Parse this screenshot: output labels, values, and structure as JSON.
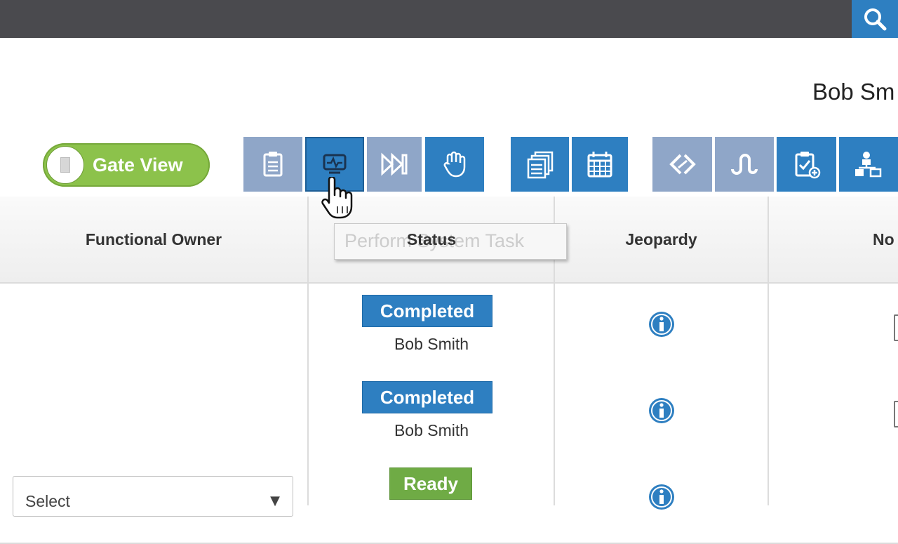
{
  "header": {
    "user_name": "Bob Sm",
    "search_icon": "search-icon"
  },
  "toolbar": {
    "gate_view_label": "Gate View",
    "buttons": [
      {
        "icon": "clipboard-icon",
        "state": "disabled"
      },
      {
        "icon": "perform-system-task-icon",
        "state": "active"
      },
      {
        "icon": "skip-forward-icon",
        "state": "disabled"
      },
      {
        "icon": "hand-stop-icon",
        "state": "enabled"
      },
      {
        "icon": "stacked-documents-icon",
        "state": "enabled"
      },
      {
        "icon": "calendar-icon",
        "state": "enabled"
      },
      {
        "icon": "diamond-flow-icon",
        "state": "disabled"
      },
      {
        "icon": "wave-flow-icon",
        "state": "disabled"
      },
      {
        "icon": "clipboard-add-icon",
        "state": "enabled"
      },
      {
        "icon": "hierarchy-icon",
        "state": "enabled"
      }
    ],
    "tooltip": "Perform System Task"
  },
  "table": {
    "columns": [
      "Functional Owner",
      "Status",
      "Jeopardy",
      "No"
    ],
    "rows": [
      {
        "functional_owner": "",
        "status": "Completed",
        "status_user": "Bob Smith"
      },
      {
        "functional_owner": "",
        "status": "Completed",
        "status_user": "Bob Smith"
      },
      {
        "functional_owner_select": "Select",
        "status": "Ready",
        "status_user": ""
      }
    ]
  },
  "colors": {
    "topbar": "#4a4a4e",
    "accent_blue": "#2e7fc1",
    "disabled_blue": "#8fa6c8",
    "toggle_green": "#8cc24b",
    "ready_green": "#6fab45"
  }
}
